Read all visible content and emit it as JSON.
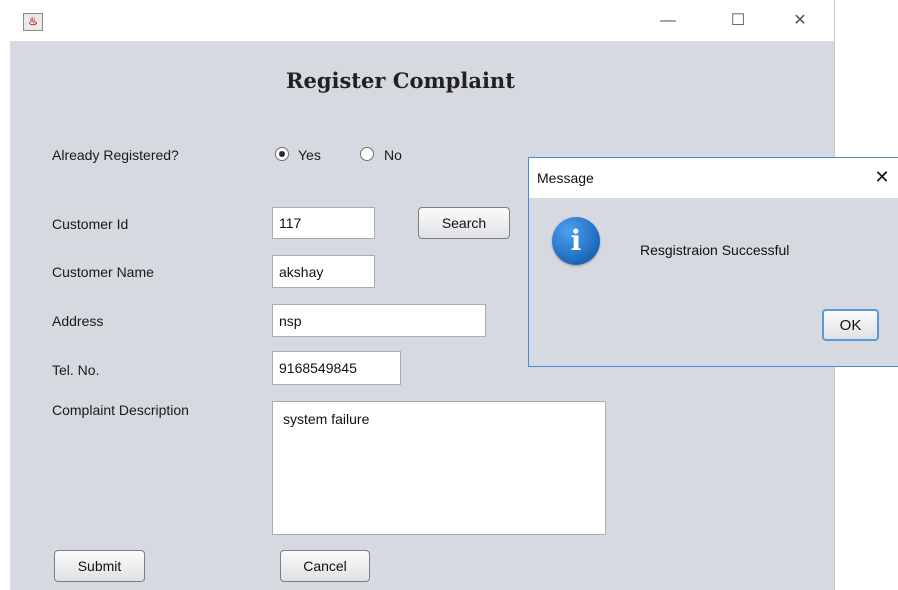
{
  "window": {
    "title": "",
    "controls": {
      "minimize": "—",
      "maximize": "☐",
      "close": "✕"
    },
    "app_icon": "java-icon"
  },
  "form": {
    "title": "Register Complaint",
    "already_registered_label": "Already Registered?",
    "radio_yes": {
      "label": "Yes",
      "selected": true
    },
    "radio_no": {
      "label": "No",
      "selected": false
    },
    "customer_id_label": "Customer Id",
    "customer_id_value": "117",
    "search_button": "Search",
    "customer_name_label": "Customer Name",
    "customer_name_value": "akshay",
    "address_label": "Address",
    "address_value": "nsp",
    "tel_label": "Tel. No.",
    "tel_value": "9168549845",
    "complaint_label": "Complaint Description",
    "complaint_value": "system failure",
    "submit_button": "Submit",
    "cancel_button": "Cancel"
  },
  "dialog": {
    "title": "Message",
    "close_glyph": "✕",
    "icon": "info-icon",
    "icon_glyph": "i",
    "message": "Resgistraion Successful",
    "ok_button": "OK"
  },
  "colors": {
    "panel_bg": "#d6d9df",
    "dialog_border": "#3f8fd8",
    "info_blue": "#1a63b7"
  }
}
